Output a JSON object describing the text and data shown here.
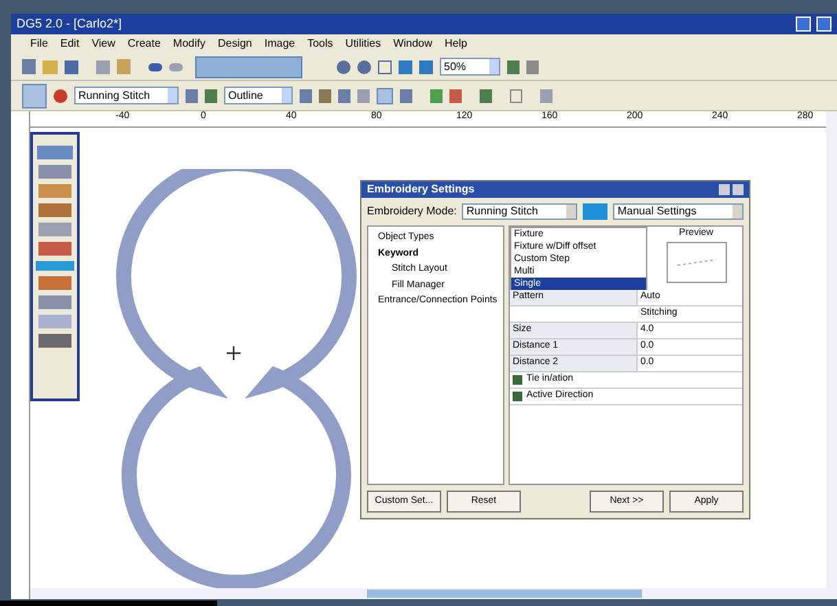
{
  "window": {
    "title": "DG5 2.0 - [Carlo2*]"
  },
  "menu": [
    "File",
    "Edit",
    "View",
    "Create",
    "Modify",
    "Design",
    "Image",
    "Tools",
    "Utilities",
    "Window",
    "Help"
  ],
  "toolbar": {
    "zoom": "50%",
    "stitch_type": "Running Stitch",
    "outline_type": "Outline"
  },
  "ruler": [
    "-40",
    "0",
    "40",
    "80",
    "120",
    "160",
    "200",
    "240",
    "280"
  ],
  "dialog": {
    "title": "Embroidery Settings",
    "mode_label": "Embroidery Mode:",
    "mode": "Running Stitch",
    "settings": "Manual Settings",
    "tree": [
      {
        "label": "Object Types",
        "bold": false
      },
      {
        "label": "Keyword",
        "bold": true,
        "children": [
          {
            "label": "Stitch Layout",
            "bold": false
          },
          {
            "label": "Fill Manager",
            "bold": false
          }
        ]
      },
      {
        "label": "Entrance/Connection Points",
        "bold": false
      }
    ],
    "list": [
      {
        "label": "Fixture",
        "selected": false
      },
      {
        "label": "Fixture w/Diff offset",
        "selected": false
      },
      {
        "label": "Custom Step",
        "selected": false
      },
      {
        "label": "Multi",
        "selected": false
      },
      {
        "label": "Single",
        "selected": true
      }
    ],
    "preview_label": "Preview",
    "properties": [
      {
        "kind": "pair",
        "name": "Pattern",
        "value": "Auto"
      },
      {
        "kind": "header",
        "name": "Stitching"
      },
      {
        "kind": "pair",
        "name": "Size",
        "value": "4.0"
      },
      {
        "kind": "pair",
        "name": "Distance 1",
        "value": "0.0"
      },
      {
        "kind": "pair",
        "name": "Distance 2",
        "value": "0.0"
      },
      {
        "kind": "check",
        "name": "Tie in/ation"
      },
      {
        "kind": "check",
        "name": "Active Direction"
      }
    ],
    "buttons": [
      "Custom Set...",
      "Reset",
      "Next >>",
      "Apply"
    ]
  }
}
